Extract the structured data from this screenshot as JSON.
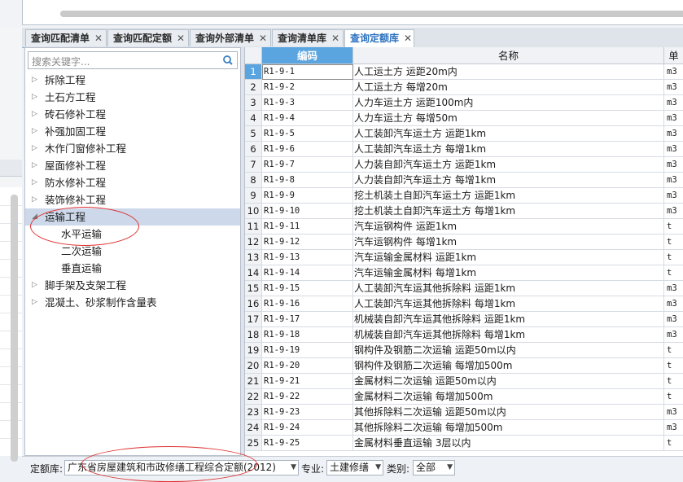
{
  "tabs": [
    {
      "label": "查询匹配清单",
      "active": false
    },
    {
      "label": "查询匹配定额",
      "active": false
    },
    {
      "label": "查询外部清单",
      "active": false
    },
    {
      "label": "查询清单库",
      "active": false
    },
    {
      "label": "查询定额库",
      "active": true
    }
  ],
  "tab_close_glyph": "✕",
  "search": {
    "placeholder": "搜索关键字..."
  },
  "tree": [
    {
      "label": "拆除工程",
      "expanded": false
    },
    {
      "label": "土石方工程",
      "expanded": false
    },
    {
      "label": "砖石修补工程",
      "expanded": false
    },
    {
      "label": "补强加固工程",
      "expanded": false
    },
    {
      "label": "木作门窗修补工程",
      "expanded": false
    },
    {
      "label": "屋面修补工程",
      "expanded": false
    },
    {
      "label": "防水修补工程",
      "expanded": false
    },
    {
      "label": "装饰修补工程",
      "expanded": false
    },
    {
      "label": "运输工程",
      "expanded": true,
      "selected": true
    },
    {
      "label": "水平运输",
      "child": true
    },
    {
      "label": "二次运输",
      "child": true
    },
    {
      "label": "垂直运输",
      "child": true
    },
    {
      "label": "脚手架及支架工程",
      "expanded": false
    },
    {
      "label": "混凝土、砂浆制作含量表",
      "expanded": false
    }
  ],
  "grid": {
    "headers": {
      "code": "编码",
      "name": "名称",
      "unit": "单"
    },
    "rows": [
      {
        "n": "1",
        "code": "R1-9-1",
        "name": "人工运土方 运距20m内",
        "unit": "m3"
      },
      {
        "n": "2",
        "code": "R1-9-2",
        "name": "人工运土方 每增20m",
        "unit": "m3"
      },
      {
        "n": "3",
        "code": "R1-9-3",
        "name": "人力车运土方 运距100m内",
        "unit": "m3"
      },
      {
        "n": "4",
        "code": "R1-9-4",
        "name": "人力车运土方 每增50m",
        "unit": "m3"
      },
      {
        "n": "5",
        "code": "R1-9-5",
        "name": "人工装卸汽车运土方 运距1km",
        "unit": "m3"
      },
      {
        "n": "6",
        "code": "R1-9-6",
        "name": "人工装卸汽车运土方 每增1km",
        "unit": "m3"
      },
      {
        "n": "7",
        "code": "R1-9-7",
        "name": "人力装自卸汽车运土方 运距1km",
        "unit": "m3"
      },
      {
        "n": "8",
        "code": "R1-9-8",
        "name": "人力装自卸汽车运土方 每增1km",
        "unit": "m3"
      },
      {
        "n": "9",
        "code": "R1-9-9",
        "name": "挖土机装土自卸汽车运土方 运距1km",
        "unit": "m3"
      },
      {
        "n": "10",
        "code": "R1-9-10",
        "name": "挖土机装土自卸汽车运土方 每增1km",
        "unit": "m3"
      },
      {
        "n": "11",
        "code": "R1-9-11",
        "name": "汽车运钢构件 运距1km",
        "unit": "t"
      },
      {
        "n": "12",
        "code": "R1-9-12",
        "name": "汽车运钢构件 每增1km",
        "unit": "t"
      },
      {
        "n": "13",
        "code": "R1-9-13",
        "name": "汽车运输金属材料 运距1km",
        "unit": "t"
      },
      {
        "n": "14",
        "code": "R1-9-14",
        "name": "汽车运输金属材料 每增1km",
        "unit": "t"
      },
      {
        "n": "15",
        "code": "R1-9-15",
        "name": "人工装卸汽车运其他拆除料 运距1km",
        "unit": "m3"
      },
      {
        "n": "16",
        "code": "R1-9-16",
        "name": "人工装卸汽车运其他拆除料 每增1km",
        "unit": "m3"
      },
      {
        "n": "17",
        "code": "R1-9-17",
        "name": "机械装自卸汽车运其他拆除料 运距1km",
        "unit": "m3"
      },
      {
        "n": "18",
        "code": "R1-9-18",
        "name": "机械装自卸汽车运其他拆除料 每增1km",
        "unit": "m3"
      },
      {
        "n": "19",
        "code": "R1-9-19",
        "name": "钢构件及钢筋二次运输 运距50m以内",
        "unit": "t"
      },
      {
        "n": "20",
        "code": "R1-9-20",
        "name": "钢构件及钢筋二次运输 每增加500m",
        "unit": "t"
      },
      {
        "n": "21",
        "code": "R1-9-21",
        "name": "金属材料二次运输 运距50m以内",
        "unit": "t"
      },
      {
        "n": "22",
        "code": "R1-9-22",
        "name": "金属材料二次运输 每增加500m",
        "unit": "t"
      },
      {
        "n": "23",
        "code": "R1-9-23",
        "name": "其他拆除料二次运输 运距50m以内",
        "unit": "m3"
      },
      {
        "n": "24",
        "code": "R1-9-24",
        "name": "其他拆除料二次运输 每增加500m",
        "unit": "m3"
      },
      {
        "n": "25",
        "code": "R1-9-25",
        "name": "金属材料垂直运输 3层以内",
        "unit": "t"
      }
    ]
  },
  "bottom": {
    "quota_label": "定额库:",
    "quota_value": "广东省房屋建筑和市政修缮工程综合定额(2012)",
    "major_label": "专业:",
    "major_value": "土建修缮",
    "category_label": "类别:",
    "category_value": "全部"
  },
  "colors": {
    "accent": "#5aa5e0",
    "selected_row": "#cdd9ea",
    "annotation": "#e03030"
  },
  "icons": {
    "search": "search-icon",
    "expand": "chevron-right-icon",
    "collapse": "triangle-down-icon",
    "dropdown": "chevron-down-icon"
  }
}
